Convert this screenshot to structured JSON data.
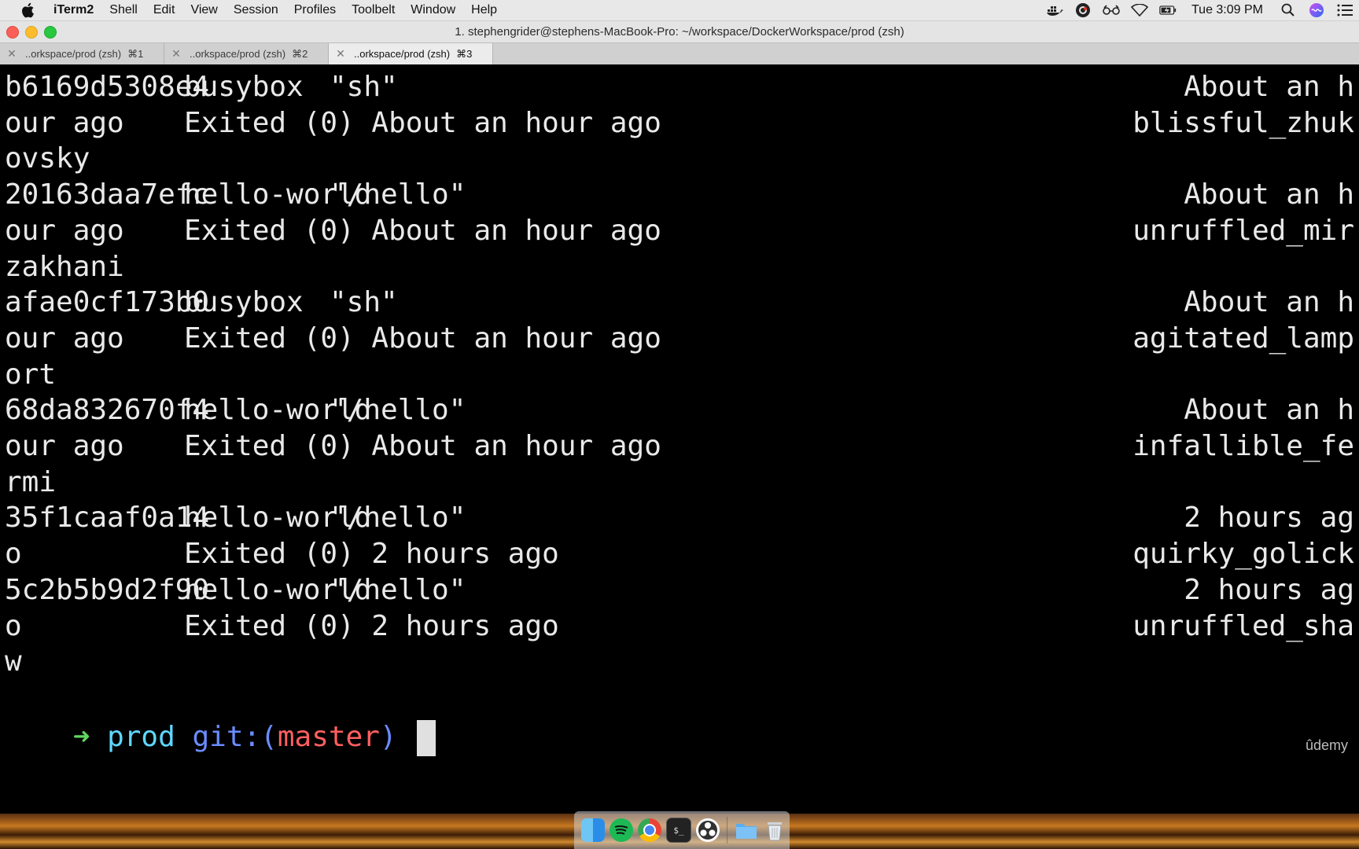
{
  "menubar": {
    "app_name": "iTerm2",
    "items": [
      "Shell",
      "Edit",
      "View",
      "Session",
      "Profiles",
      "Toolbelt",
      "Window",
      "Help"
    ],
    "clock": "Tue 3:09 PM",
    "status_icons": [
      "docker-icon",
      "creative-cloud-icon",
      "accessibility-icon",
      "wifi-icon",
      "battery-icon",
      "search-icon",
      "siri-icon",
      "control-list-icon"
    ]
  },
  "window": {
    "title": "1. stephengrider@stephens-MacBook-Pro: ~/workspace/DockerWorkspace/prod (zsh)"
  },
  "tabs": [
    {
      "label": "..orkspace/prod (zsh)",
      "shortcut": "⌘1",
      "active": false
    },
    {
      "label": "..orkspace/prod (zsh)",
      "shortcut": "⌘2",
      "active": false
    },
    {
      "label": "..orkspace/prod (zsh)",
      "shortcut": "⌘3",
      "active": true
    }
  ],
  "terminal": {
    "lines": [
      [
        "b6169d5308e4",
        "busybox",
        "\"sh\"",
        "About an h"
      ],
      [
        "our ago",
        "Exited (0) About an hour ago",
        "",
        "blissful_zhuk"
      ],
      [
        "ovsky",
        "",
        "",
        ""
      ],
      [
        "20163daa7efc",
        "hello-world",
        "\"/hello\"",
        "About an h"
      ],
      [
        "our ago",
        "Exited (0) About an hour ago",
        "",
        "unruffled_mir"
      ],
      [
        "zakhani",
        "",
        "",
        ""
      ],
      [
        "afae0cf173b0",
        "busybox",
        "\"sh\"",
        "About an h"
      ],
      [
        "our ago",
        "Exited (0) About an hour ago",
        "",
        "agitated_lamp"
      ],
      [
        "ort",
        "",
        "",
        ""
      ],
      [
        "68da832670f4",
        "hello-world",
        "\"/hello\"",
        "About an h"
      ],
      [
        "our ago",
        "Exited (0) About an hour ago",
        "",
        "infallible_fe"
      ],
      [
        "rmi",
        "",
        "",
        ""
      ],
      [
        "35f1caaf0a14",
        "hello-world",
        "\"/hello\"",
        "2 hours ag"
      ],
      [
        "o",
        "Exited (0) 2 hours ago",
        "",
        "quirky_golick"
      ],
      [
        "5c2b5b9d2f90",
        "hello-world",
        "\"/hello\"",
        "2 hours ag"
      ],
      [
        "o",
        "Exited (0) 2 hours ago",
        "",
        "unruffled_sha"
      ],
      [
        "w",
        "",
        "",
        ""
      ]
    ],
    "prompt": {
      "arrow": "➜",
      "directory": "prod",
      "git_label": "git:(",
      "branch": "master",
      "git_close": ")"
    },
    "watermark": "ûdemy"
  },
  "dock": {
    "apps": [
      "finder-icon",
      "spotify-icon",
      "chrome-icon",
      "terminal-icon",
      "obs-icon",
      "folder-icon",
      "trash-icon"
    ]
  },
  "colors": {
    "terminal_bg": "#000000",
    "terminal_fg": "#e9e9e9",
    "prompt_arrow": "#5fd75f",
    "prompt_dir": "#5fd7ff",
    "prompt_git": "#6b8cff",
    "prompt_branch": "#ff5f5f"
  }
}
